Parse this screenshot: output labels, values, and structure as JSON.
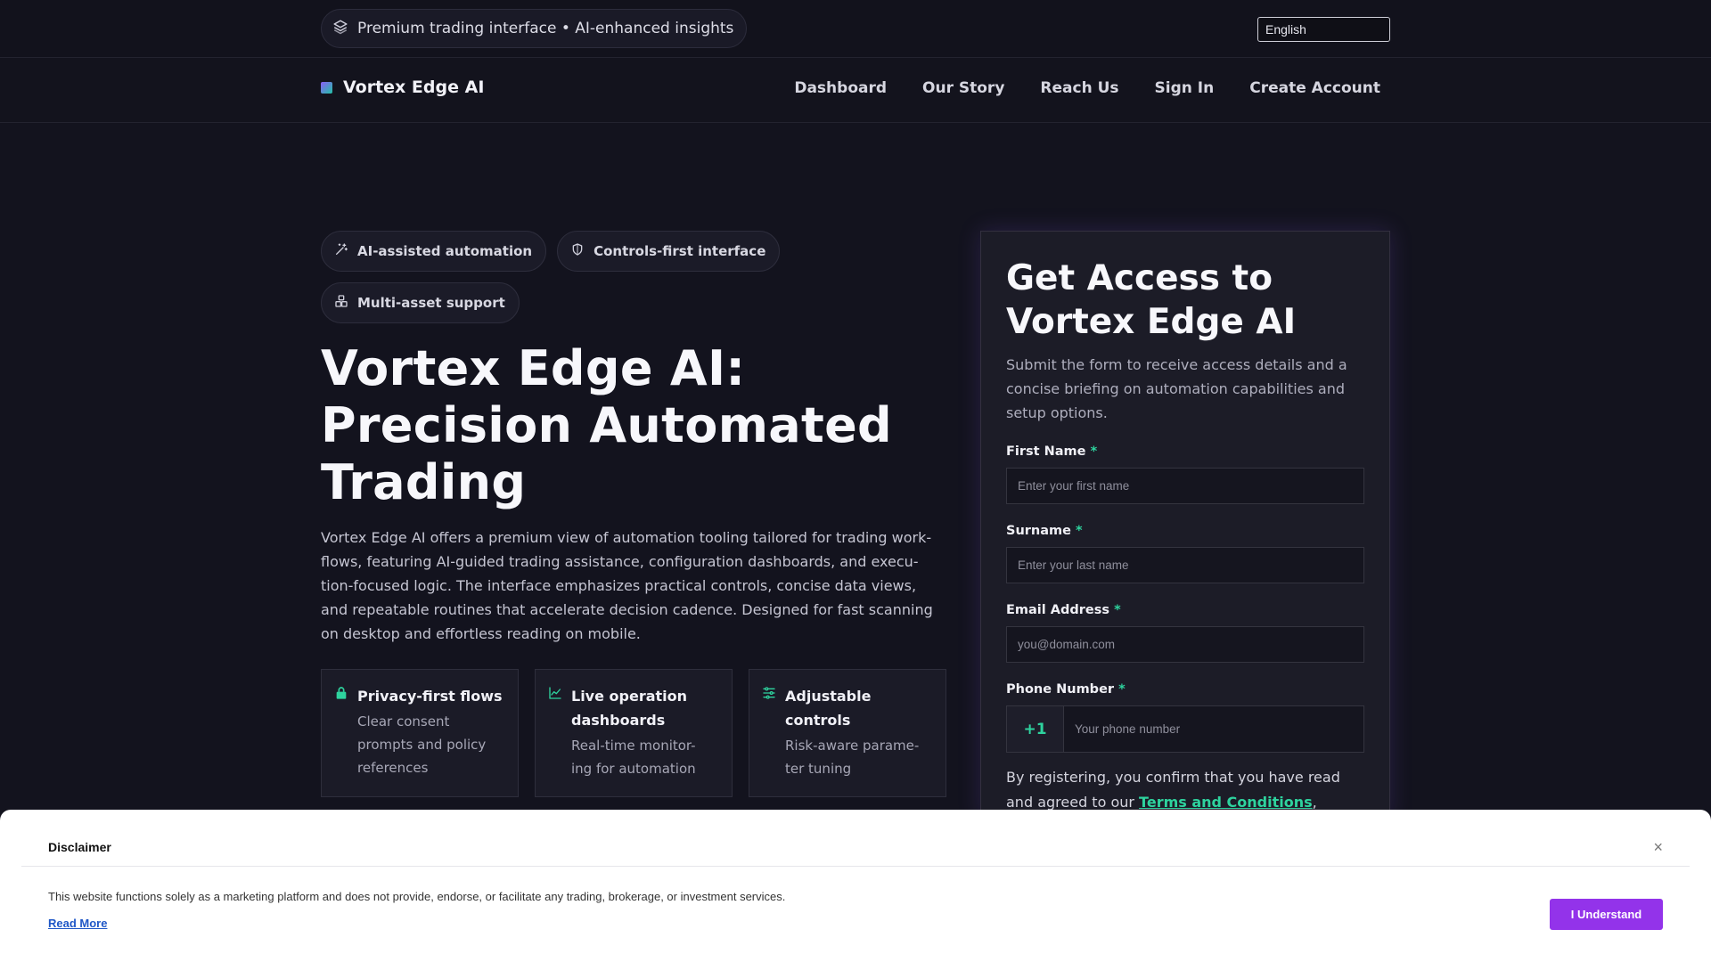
{
  "topbar": {
    "promo_text": "Premium trading interface • AI-enhanced insights",
    "promo_icon": "layers-icon",
    "language": "English"
  },
  "nav": {
    "brand": "Vortex Edge AI",
    "links": [
      "Dashboard",
      "Our Story",
      "Reach Us",
      "Sign In",
      "Create Account"
    ]
  },
  "hero": {
    "tags": [
      {
        "label": "AI-assisted automation",
        "icon": "magic-wand-icon"
      },
      {
        "label": "Controls-first interface",
        "icon": "shield-icon"
      },
      {
        "label": "Multi-asset support",
        "icon": "assets-icon"
      }
    ],
    "title_lines": [
      "Vortex Edge AI:",
      "Precision Automated",
      "Trading"
    ],
    "description_lines": [
      "Vortex Edge AI offers a premium view of automation tooling tailored for trading work-",
      "flows, featuring AI-guided trading assistance, configuration dashboards, and execu-",
      "tion-focused logic. The interface emphasizes practical controls, concise data views,",
      "and repeatable routines that accelerate decision cadence. Designed for fast scanning",
      "on desktop and effortless reading on mobile."
    ],
    "features": [
      {
        "icon": "lock-icon",
        "title_lines": [
          "Privacy-first flows"
        ],
        "desc_lines": [
          "Clear consent",
          "prompts and policy",
          "references"
        ]
      },
      {
        "icon": "chart-line-icon",
        "title_lines": [
          "Live operation",
          "dashboards"
        ],
        "desc_lines": [
          "Real-time monitor-",
          "ing for automation"
        ]
      },
      {
        "icon": "sliders-icon",
        "title_lines": [
          "Adjustable",
          "controls"
        ],
        "desc_lines": [
          "Risk-aware parame-",
          "ter tuning"
        ]
      }
    ]
  },
  "form": {
    "title_lines": [
      "Get Access to",
      "Vortex Edge AI"
    ],
    "subtitle_lines": [
      "Submit the form to receive access details and a",
      "concise briefing on automation capabilities and",
      "setup options."
    ],
    "first_name": {
      "label": "First Name",
      "placeholder": "Enter your first name"
    },
    "surname": {
      "label": "Surname",
      "placeholder": "Enter your last name"
    },
    "email": {
      "label": "Email Address",
      "placeholder": "you@domain.com"
    },
    "phone": {
      "label": "Phone Number",
      "code": "+1",
      "placeholder": "Your phone number"
    },
    "required_mark": "*",
    "consent_line1": "By registering, you confirm that you have read",
    "consent_line2": "and agreed to our ",
    "terms_link": "Terms and Conditions",
    "terms_trailing": ","
  },
  "disclaimer": {
    "title": "Disclaimer",
    "text": "This website functions solely as a marketing platform and does not provide, endorse, or facilitate any trading, brokerage, or investment services.",
    "read_more": "Read More",
    "button": "I Understand",
    "close": "×"
  },
  "colors": {
    "accent_green": "#2ed39e",
    "accent_purple": "#9333ea",
    "background": "#13131e"
  }
}
